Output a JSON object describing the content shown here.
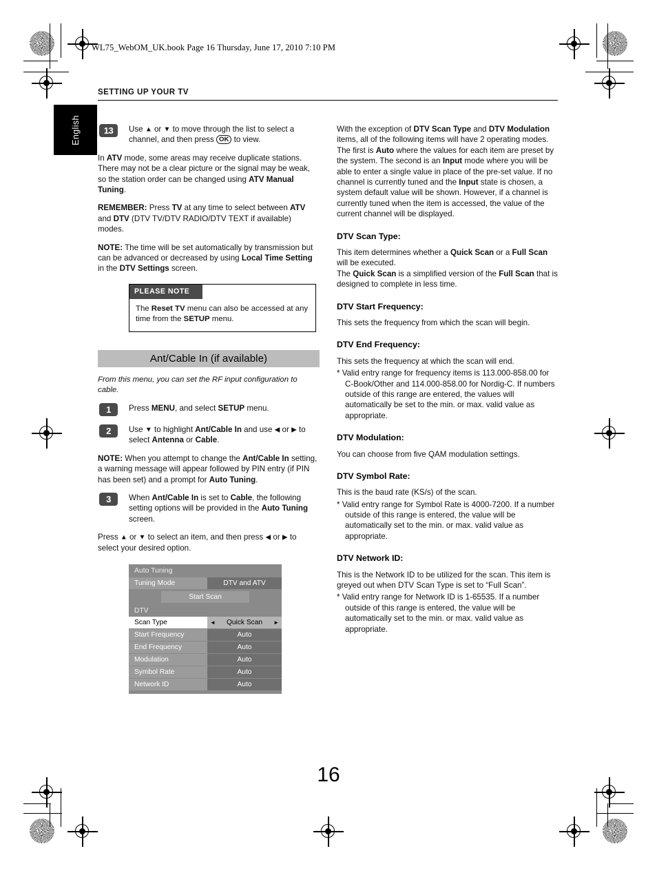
{
  "print": {
    "book_line": "WL75_WebOM_UK.book  Page 16  Thursday, June 17, 2010  7:10 PM",
    "section_header": "SETTING UP YOUR TV",
    "language_tab": "English",
    "page_number": "16"
  },
  "left_column": {
    "step13": {
      "number": "13",
      "para1_pre": "Use ",
      "para1_mid": " or ",
      "para1_post": " to move through the list to select a channel, and then press ",
      "ok_key": "OK",
      "para1_end": " to view.",
      "para2": "In ATV mode, some areas may receive duplicate stations. There may not be a clear picture or the signal may be weak, so the station order can be changed using ATV Manual Tuning.",
      "para3": "REMEMBER: Press TV at any time to select between ATV and DTV (DTV TV/DTV RADIO/DTV TEXT if available) modes.",
      "para4": "NOTE: The time will be set automatically by transmission but can be advanced or decreased by using Local Time Setting in the DTV Settings screen."
    },
    "please_note": {
      "heading": "PLEASE NOTE",
      "body": "The Reset TV menu can also be accessed at any time from the SETUP menu."
    },
    "banner": "Ant/Cable In (if available)",
    "intro": "From this menu, you can set the RF input configuration to cable.",
    "step1": {
      "number": "1",
      "text": "Press MENU, and select SETUP menu."
    },
    "step2": {
      "number": "2",
      "text": "Use ▼ to highlight Ant/Cable In and use ◄ or ► to select Antenna or Cable.",
      "note": "NOTE: When you attempt to change the Ant/Cable In setting, a warning message will appear followed by PIN entry (if PIN has been set) and a prompt for Auto Tuning."
    },
    "step3": {
      "number": "3",
      "text": "When Ant/Cable In is set to Cable, the following setting options will be provided in the Auto Tuning screen.",
      "text2": "Press ▲ or ▼ to select an item, and then press ◄ or ► to select your desired option."
    }
  },
  "osd_menu": {
    "title": "Auto Tuning",
    "tuning_mode_label": "Tuning Mode",
    "tuning_mode_value": "DTV and ATV",
    "start_scan_button": "Start Scan",
    "group_label": "DTV",
    "rows": [
      {
        "label": "Scan Type",
        "value": "Quick Scan",
        "selected": true
      },
      {
        "label": "Start Frequency",
        "value": "Auto",
        "selected": false
      },
      {
        "label": "End Frequency",
        "value": "Auto",
        "selected": false
      },
      {
        "label": "Modulation",
        "value": "Auto",
        "selected": false
      },
      {
        "label": "Symbol Rate",
        "value": "Auto",
        "selected": false
      },
      {
        "label": "Network ID",
        "value": "Auto",
        "selected": false
      }
    ],
    "left_arrow": "◄",
    "right_arrow": "►"
  },
  "right_column": {
    "intro": "With the exception of DTV Scan Type and DTV Modulation items, all of the following items will have 2 operating modes. The first is Auto where the values for each item are preset by the system. The second is an Input mode where you will be able to enter a single value in place of the pre-set value. If no channel is currently tuned and the Input state is chosen, a system default value will be shown. However, if a channel is currently tuned when the item is accessed, the value of the current channel will be displayed.",
    "sections": [
      {
        "heading": "DTV Scan Type:",
        "body1": "This item determines whether a Quick Scan or a Full Scan will be executed.",
        "body2": "The Quick Scan is a simplified version of the Full Scan that is designed to complete in less time."
      },
      {
        "heading": "DTV Start Frequency:",
        "body1": "This sets the frequency from which the scan will begin."
      },
      {
        "heading": "DTV End Frequency:",
        "body1": "This sets the frequency at which the scan will end.",
        "note": "* Valid entry range for frequency items is 113.000-858.00 for C-Book/Other and 114.000-858.00 for Nordig-C. If numbers outside of this range are entered, the values will automatically be set to the min. or max. valid value as appropriate."
      },
      {
        "heading": "DTV Modulation:",
        "body1": "You can choose from five QAM modulation settings."
      },
      {
        "heading": "DTV Symbol Rate:",
        "body1": "This is the baud rate (KS/s) of the scan.",
        "note": "* Valid entry range for Symbol Rate is 4000-7200. If a number outside of this range is entered, the value will be automatically set to the min. or max. valid value as appropriate."
      },
      {
        "heading": "DTV Network ID:",
        "body1": "This is the Network ID to be utilized for the scan. This item is greyed out when DTV Scan Type is set to “Full Scan”.",
        "note": "* Valid entry range for Network ID is 1-65535. If a number outside of this range is entered, the value will be automatically set to the min. or max. valid value as appropriate."
      }
    ]
  }
}
